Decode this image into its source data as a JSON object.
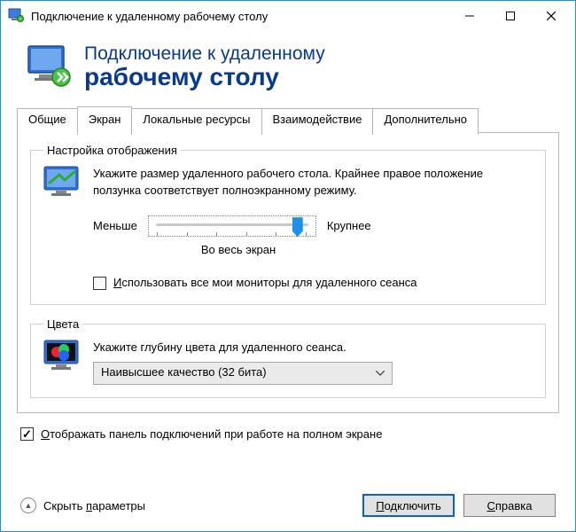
{
  "titlebar": {
    "title": "Подключение к удаленному рабочему столу"
  },
  "header": {
    "line1": "Подключение к удаленному",
    "line2": "рабочему столу"
  },
  "tabs": {
    "general": "Общие",
    "screen": "Экран",
    "local": "Локальные ресурсы",
    "experience": "Взаимодействие",
    "advanced": "Дополнительно"
  },
  "display_group": {
    "legend": "Настройка отображения",
    "desc": "Укажите размер удаленного рабочего стола. Крайнее правое положение ползунка соответствует полноэкранному режиму.",
    "smaller": "Меньше",
    "larger": "Крупнее",
    "value_label": "Во весь экран",
    "all_monitors_prefix": "И",
    "all_monitors_rest": "спользовать все мои мониторы для удаленного сеанса"
  },
  "colors_group": {
    "legend": "Цвета",
    "desc": "Укажите глубину цвета для удаленного сеанса.",
    "selected": "Наивысшее качество (32 бита)"
  },
  "connection_bar": {
    "prefix": "О",
    "rest": "тображать панель подключений при работе на полном экране"
  },
  "footer": {
    "hide_prefix": "п",
    "hide_pre": "Скрыть ",
    "hide_post": "араметры",
    "connect_prefix": "П",
    "connect_rest": "одключить",
    "help_prefix": "С",
    "help_rest": "правка"
  }
}
